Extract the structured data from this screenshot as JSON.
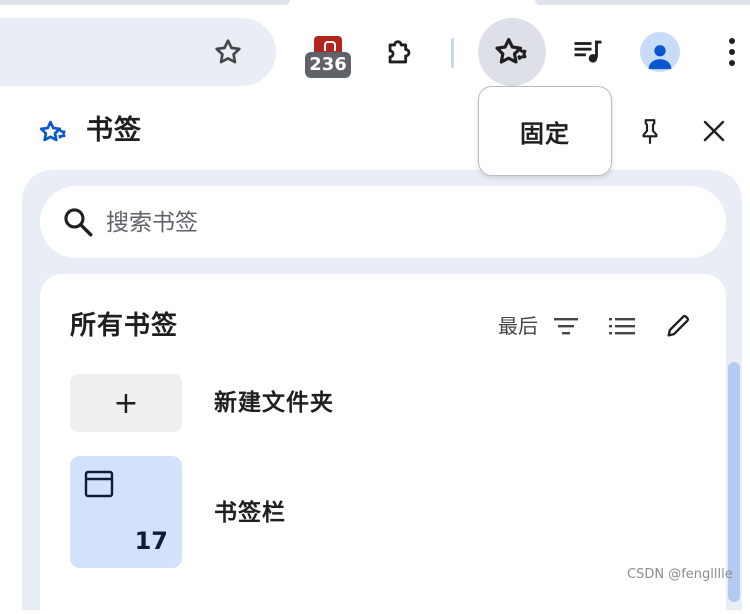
{
  "toolbar": {
    "extension_badge": "236"
  },
  "tooltip": {
    "text": "固定"
  },
  "panel": {
    "title": "书签",
    "search_placeholder": "搜索书签",
    "section_title": "所有书签",
    "sort_label": "最后",
    "items": [
      {
        "label": "新建文件夹",
        "icon": "plus-icon"
      },
      {
        "label": "书签栏",
        "icon": "bookmarks-bar-icon",
        "count": "17"
      }
    ]
  },
  "watermark": "CSDN @fenglllle",
  "colors": {
    "accent": "#0b57d0",
    "panel_bg": "#e9edf6",
    "folder_tile": "#d3e2fb",
    "scrollbar": "#b6c9f3"
  }
}
